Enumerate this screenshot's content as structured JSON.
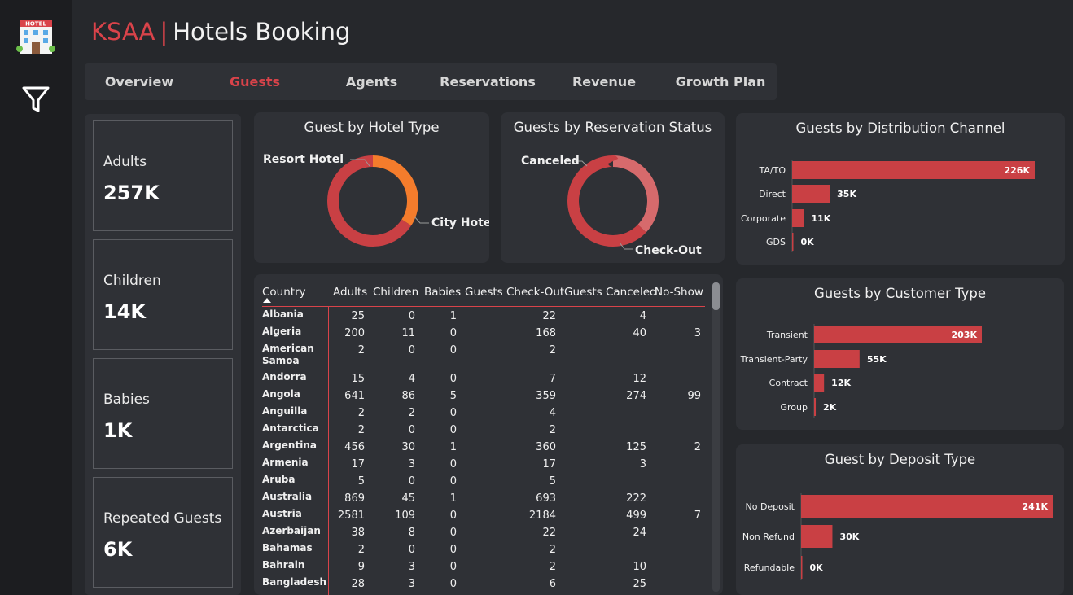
{
  "header": {
    "brand": "KSAA",
    "separator": "|",
    "subtitle": "Hotels Booking"
  },
  "tabs": [
    "Overview",
    "Guests",
    "Agents",
    "Reservations",
    "Revenue",
    "Growth Plan"
  ],
  "active_tab": "Guests",
  "kpis": [
    {
      "label": "Adults",
      "value": "257K"
    },
    {
      "label": "Children",
      "value": "14K"
    },
    {
      "label": "Babies",
      "value": "1K"
    },
    {
      "label": "Repeated Guests",
      "value": "6K"
    }
  ],
  "colors": {
    "accent": "#d9434a",
    "bar": "#c94044",
    "resort": "#f47c2c",
    "canceled": "#d66a6c",
    "panel": "#2f3136"
  },
  "chart_data": [
    {
      "type": "pie",
      "title": "Guest by Hotel Type",
      "categories": [
        "Resort Hotel",
        "City Hotel"
      ],
      "values": [
        34,
        66
      ]
    },
    {
      "type": "pie",
      "title": "Guests by Reservation Status",
      "categories": [
        "Canceled",
        "Check-Out"
      ],
      "values": [
        37,
        63
      ]
    },
    {
      "type": "bar",
      "title": "Guests by Distribution Channel",
      "categories": [
        "TA/TO",
        "Direct",
        "Corporate",
        "GDS"
      ],
      "values": [
        226,
        35,
        11,
        0
      ],
      "labels": [
        "226K",
        "35K",
        "11K",
        "0K"
      ],
      "orientation": "horizontal"
    },
    {
      "type": "bar",
      "title": "Guests by Customer Type",
      "categories": [
        "Transient",
        "Transient-Party",
        "Contract",
        "Group"
      ],
      "values": [
        203,
        55,
        12,
        2
      ],
      "labels": [
        "203K",
        "55K",
        "12K",
        "2K"
      ],
      "orientation": "horizontal"
    },
    {
      "type": "bar",
      "title": "Guest by Deposit Type",
      "categories": [
        "No Deposit",
        "Non Refund",
        "Refundable"
      ],
      "values": [
        241,
        30,
        0
      ],
      "labels": [
        "241K",
        "30K",
        "0K"
      ],
      "orientation": "horizontal"
    }
  ],
  "table": {
    "columns": [
      "Country",
      "Adults",
      "Children",
      "Babies",
      "Guests Check-Out",
      "Guests Canceled",
      "No-Show"
    ],
    "rows": [
      [
        "Albania",
        "25",
        "0",
        "1",
        "22",
        "4",
        ""
      ],
      [
        "Algeria",
        "200",
        "11",
        "0",
        "168",
        "40",
        "3"
      ],
      [
        "American Samoa",
        "2",
        "0",
        "0",
        "2",
        "",
        ""
      ],
      [
        "Andorra",
        "15",
        "4",
        "0",
        "7",
        "12",
        ""
      ],
      [
        "Angola",
        "641",
        "86",
        "5",
        "359",
        "274",
        "99"
      ],
      [
        "Anguilla",
        "2",
        "2",
        "0",
        "4",
        "",
        ""
      ],
      [
        "Antarctica",
        "2",
        "0",
        "0",
        "2",
        "",
        ""
      ],
      [
        "Argentina",
        "456",
        "30",
        "1",
        "360",
        "125",
        "2"
      ],
      [
        "Armenia",
        "17",
        "3",
        "0",
        "17",
        "3",
        ""
      ],
      [
        "Aruba",
        "5",
        "0",
        "0",
        "5",
        "",
        ""
      ],
      [
        "Australia",
        "869",
        "45",
        "1",
        "693",
        "222",
        ""
      ],
      [
        "Austria",
        "2581",
        "109",
        "0",
        "2184",
        "499",
        "7"
      ],
      [
        "Azerbaijan",
        "38",
        "8",
        "0",
        "22",
        "24",
        ""
      ],
      [
        "Bahamas",
        "2",
        "0",
        "0",
        "2",
        "",
        ""
      ],
      [
        "Bahrain",
        "9",
        "3",
        "0",
        "2",
        "10",
        ""
      ],
      [
        "Bangladesh",
        "28",
        "3",
        "0",
        "6",
        "25",
        ""
      ]
    ]
  }
}
